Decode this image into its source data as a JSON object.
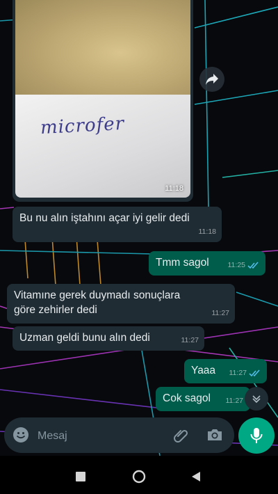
{
  "chat": {
    "photo": {
      "handwritten_text": "microfer",
      "time": "11:18"
    },
    "messages": [
      {
        "direction": "in",
        "lines": [
          "Bu nu alın iştahını açar iyi gelir dedi"
        ],
        "time": "11:18"
      },
      {
        "direction": "out",
        "lines": [
          "Tmm sagol"
        ],
        "time": "11:25",
        "status": "read"
      },
      {
        "direction": "in",
        "lines": [
          "Vitamıne gerek duymadı sonuçlara",
          "göre zehirler dedi"
        ],
        "time": "11:27"
      },
      {
        "direction": "in",
        "lines": [
          "Uzman geldi bunu alın dedi"
        ],
        "time": "11:27"
      },
      {
        "direction": "out",
        "lines": [
          "Yaaa"
        ],
        "time": "11:27",
        "status": "read"
      },
      {
        "direction": "out",
        "lines": [
          "Cok sagol"
        ],
        "time": "11:27"
      }
    ]
  },
  "composer": {
    "placeholder": "Mesaj",
    "icons": [
      "emoji-icon",
      "paperclip-icon",
      "camera-icon",
      "microphone-icon"
    ]
  },
  "navigation": {
    "icons": [
      "recents-square-icon",
      "home-circle-icon",
      "back-triangle-icon"
    ]
  },
  "colors": {
    "incoming_bubble": "#1f2c34",
    "outgoing_bubble": "#005c4b",
    "read_ticks": "#53bdeb",
    "accent": "#00a884"
  }
}
